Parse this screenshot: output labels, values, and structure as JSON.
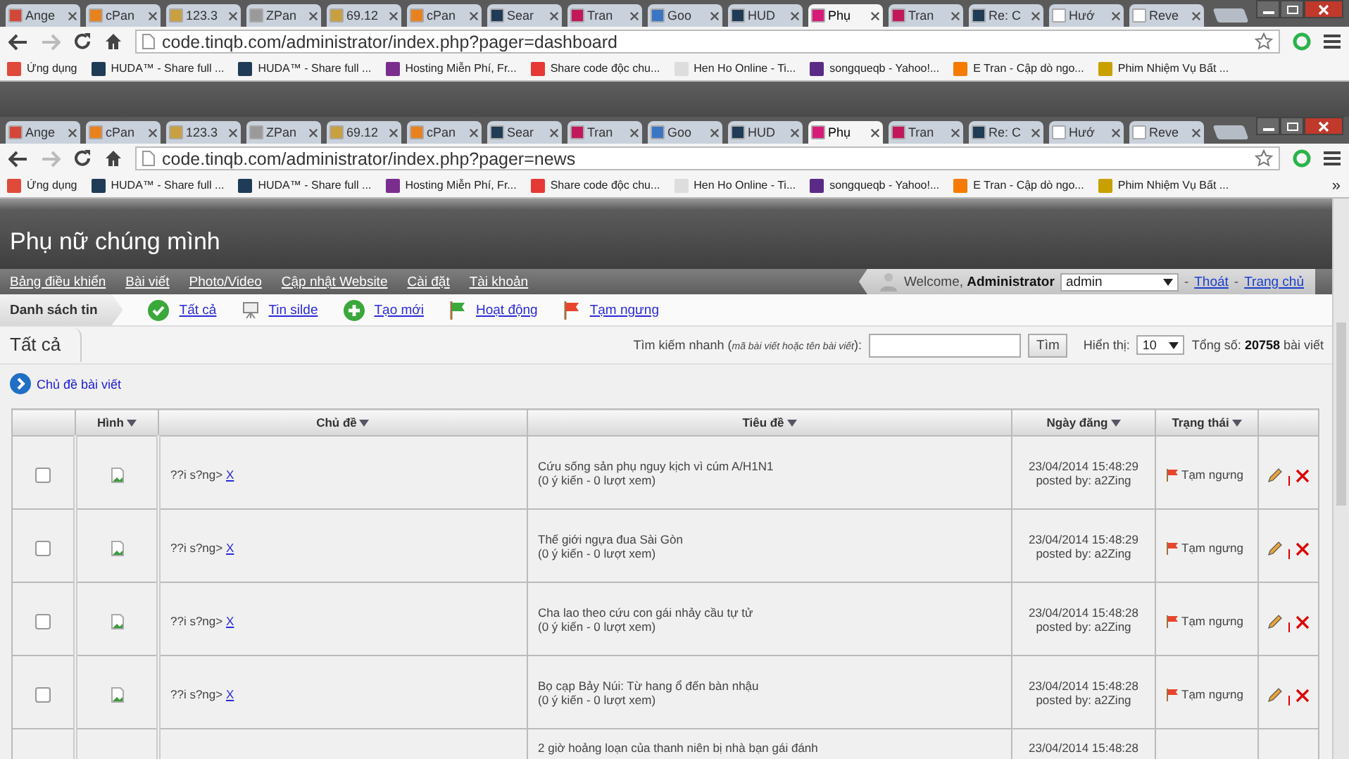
{
  "windows": [
    {
      "tabs": [
        {
          "label": "Ange",
          "color": "#d44638",
          "selected": false
        },
        {
          "label": "cPan",
          "color": "#e8821e",
          "selected": false
        },
        {
          "label": "123.3",
          "color": "#c8a040",
          "selected": false
        },
        {
          "label": "ZPan",
          "color": "#9a9a9a",
          "selected": false
        },
        {
          "label": "69.12",
          "color": "#c8a040",
          "selected": false
        },
        {
          "label": "cPan",
          "color": "#e8821e",
          "selected": false
        },
        {
          "label": "Sear",
          "color": "#1f3b55",
          "selected": false
        },
        {
          "label": "Tran",
          "color": "#c2185b",
          "selected": false
        },
        {
          "label": "Goo",
          "color": "#3a76c4",
          "selected": false
        },
        {
          "label": "HUD",
          "color": "#1f3b55",
          "selected": false
        },
        {
          "label": "Phụ",
          "color": "#d81b79",
          "selected": true
        },
        {
          "label": "Tran",
          "color": "#c2185b",
          "selected": false
        },
        {
          "label": "Re: C",
          "color": "#1f3b55",
          "selected": false
        },
        {
          "label": "Hướ",
          "color": "#ffffff",
          "selected": false
        },
        {
          "label": "Reve",
          "color": "#ffffff",
          "selected": false
        }
      ],
      "url": "code.tinqb.com/administrator/index.php?pager=dashboard",
      "more_bookmarks": false,
      "bookmarks": [
        {
          "label": "Ứng dụng",
          "color": "#e04a3a"
        },
        {
          "label": "HUDA™ - Share full ...",
          "color": "#1f3b55"
        },
        {
          "label": "HUDA™ - Share full ...",
          "color": "#1f3b55"
        },
        {
          "label": "Hosting Miễn Phí, Fr...",
          "color": "#7b2d8e"
        },
        {
          "label": "Share code độc chu...",
          "color": "#e53935"
        },
        {
          "label": "Hen Ho Online - Ti...",
          "color": "#dddddd"
        },
        {
          "label": "songqueqb - Yahoo!...",
          "color": "#5b2a86"
        },
        {
          "label": "E Tran - Cập dò ngo...",
          "color": "#f57c00"
        },
        {
          "label": "Phim Nhiệm Vụ Bất ...",
          "color": "#c8a000"
        }
      ]
    },
    {
      "tabs": [
        {
          "label": "Ange",
          "color": "#d44638",
          "selected": false
        },
        {
          "label": "cPan",
          "color": "#e8821e",
          "selected": false
        },
        {
          "label": "123.3",
          "color": "#c8a040",
          "selected": false
        },
        {
          "label": "ZPan",
          "color": "#9a9a9a",
          "selected": false
        },
        {
          "label": "69.12",
          "color": "#c8a040",
          "selected": false
        },
        {
          "label": "cPan",
          "color": "#e8821e",
          "selected": false
        },
        {
          "label": "Sear",
          "color": "#1f3b55",
          "selected": false
        },
        {
          "label": "Tran",
          "color": "#c2185b",
          "selected": false
        },
        {
          "label": "Goo",
          "color": "#3a76c4",
          "selected": false
        },
        {
          "label": "HUD",
          "color": "#1f3b55",
          "selected": false
        },
        {
          "label": "Phụ",
          "color": "#d81b79",
          "selected": true
        },
        {
          "label": "Tran",
          "color": "#c2185b",
          "selected": false
        },
        {
          "label": "Re: C",
          "color": "#1f3b55",
          "selected": false
        },
        {
          "label": "Hướ",
          "color": "#ffffff",
          "selected": false
        },
        {
          "label": "Reve",
          "color": "#ffffff",
          "selected": false
        }
      ],
      "url": "code.tinqb.com/administrator/index.php?pager=news",
      "more_bookmarks": true,
      "bookmarks": [
        {
          "label": "Ứng dụng",
          "color": "#e04a3a"
        },
        {
          "label": "HUDA™ - Share full ...",
          "color": "#1f3b55"
        },
        {
          "label": "HUDA™ - Share full ...",
          "color": "#1f3b55"
        },
        {
          "label": "Hosting Miễn Phí, Fr...",
          "color": "#7b2d8e"
        },
        {
          "label": "Share code độc chu...",
          "color": "#e53935"
        },
        {
          "label": "Hen Ho Online - Ti...",
          "color": "#dddddd"
        },
        {
          "label": "songqueqb - Yahoo!...",
          "color": "#5b2a86"
        },
        {
          "label": "E Tran - Cập dò ngo...",
          "color": "#f57c00"
        },
        {
          "label": "Phim Nhiệm Vụ Bất ...",
          "color": "#c8a000"
        }
      ]
    }
  ],
  "more_bookmarks_label": "»",
  "site": {
    "title": "Phụ nữ chúng mình",
    "nav": [
      "Bảng điều khiển",
      "Bài viết",
      "Photo/Video",
      "Cập nhật Website",
      "Cài đặt",
      "Tài khoản"
    ],
    "welcome": "Welcome, **Administrator**",
    "user_select": "admin",
    "user_links": [
      {
        "sep": "-",
        "label": "Thoát"
      },
      {
        "sep": "-",
        "label": "Trang chủ"
      }
    ],
    "subnav_title": "Danh sách tin",
    "subnav": [
      {
        "kind": "check",
        "label": "Tất cả"
      },
      {
        "kind": "slide",
        "label": "Tin silde"
      },
      {
        "kind": "plus",
        "label": "Tạo mới"
      },
      {
        "kind": "flag-green",
        "label": "Hoạt động"
      },
      {
        "kind": "flag-red",
        "label": "Tạm ngưng"
      }
    ],
    "page_tab": "Tất cả",
    "search_label": "Tìm kiếm nhanh (*mã bài viết hoặc tên bài viết*):",
    "search_button": "Tìm",
    "show_label": "Hiển thị:",
    "show_value": "10",
    "total": "Tổng số: **20758** bài viết",
    "section": "Chủ đề bài viết"
  },
  "table": {
    "columns": [
      {
        "sortable": false
      },
      {
        "label": "Hình",
        "sortable": true
      },
      {
        "label": "Chủ đề",
        "sortable": true
      },
      {
        "label": "Tiêu đề",
        "sortable": true
      },
      {
        "label": "Ngày đăng",
        "sortable": true
      },
      {
        "label": "Trạng thái",
        "sortable": true
      },
      {
        "sortable": false
      }
    ],
    "rows": [
      {
        "checked": false,
        "topic": "??i s?ng>",
        "topic_link": "X",
        "title": "Cứu sống sản phụ nguy kịch vì cúm A/H1N1",
        "stats": "(0 ý kiến - 0 lượt xem)",
        "date": "23/04/2014 15:48:29",
        "posted": "posted by: a2Zing",
        "status": "Tạm ngưng",
        "active": false
      },
      {
        "checked": false,
        "topic": "??i s?ng>",
        "topic_link": "X",
        "title": "Thế giới ngựa đua Sài Gòn",
        "stats": "(0 ý kiến - 0 lượt xem)",
        "date": "23/04/2014 15:48:29",
        "posted": "posted by: a2Zing",
        "status": "Tạm ngưng",
        "active": false
      },
      {
        "checked": false,
        "topic": "??i s?ng>",
        "topic_link": "X",
        "title": "Cha lao theo cứu con gái nhảy cầu tự tử",
        "stats": "(0 ý kiến - 0 lượt xem)",
        "date": "23/04/2014 15:48:28",
        "posted": "posted by: a2Zing",
        "status": "Tạm ngưng",
        "active": false
      },
      {
        "checked": false,
        "topic": "??i s?ng>",
        "topic_link": "X",
        "title": "Bọ cạp Bảy Núi: Từ hang ổ đến bàn nhậu",
        "stats": "(0 ý kiến - 0 lượt xem)",
        "date": "23/04/2014 15:48:28",
        "posted": "posted by: a2Zing",
        "status": "Tạm ngưng",
        "active": false
      },
      {
        "title": "2 giờ hoảng loạn của thanh niên bị nhà bạn gái đánh",
        "date": "23/04/2014 15:48:28"
      }
    ]
  }
}
